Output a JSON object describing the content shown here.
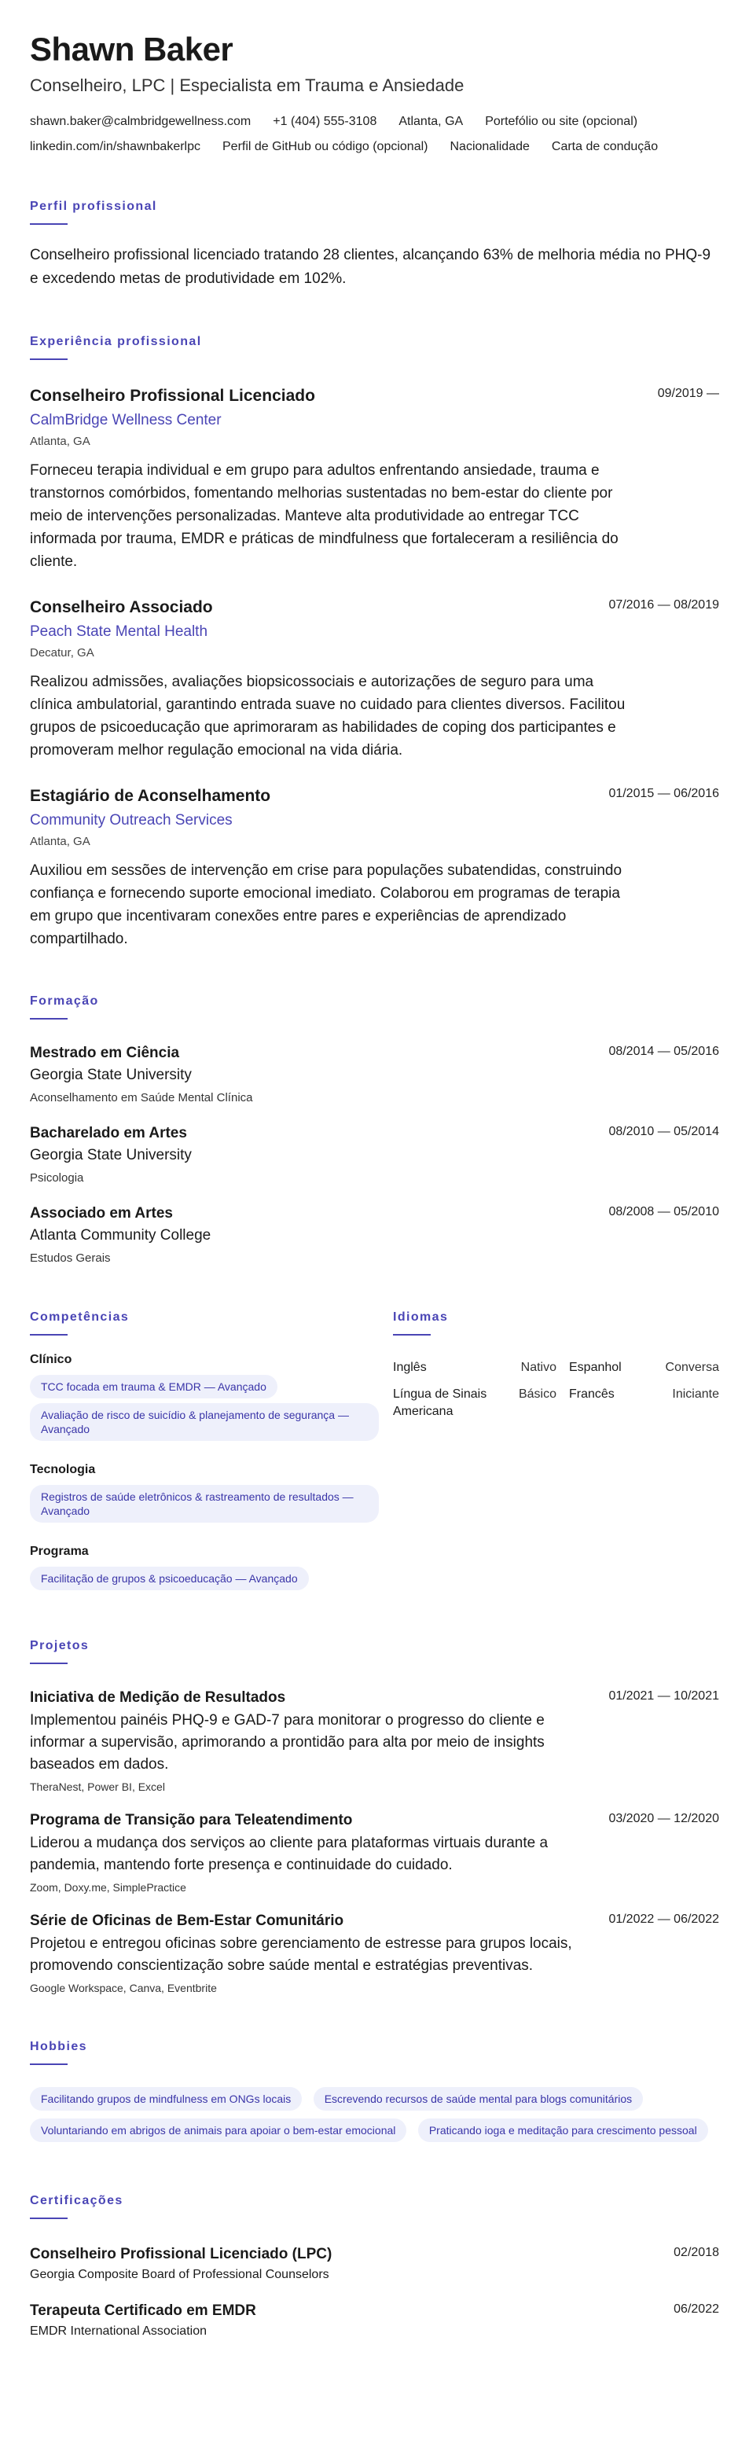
{
  "header": {
    "name": "Shawn Baker",
    "headline": "Conselheiro, LPC | Especialista em Trauma e Ansiedade",
    "contacts": [
      "shawn.baker@calmbridgewellness.com",
      "+1 (404) 555-3108",
      "Atlanta, GA",
      "Portefólio ou site (opcional)",
      "linkedin.com/in/shawnbakerlpc",
      "Perfil de GitHub ou código (opcional)",
      "Nacionalidade",
      "Carta de condução"
    ]
  },
  "summary": {
    "title": "Perfil profissional",
    "text": "Conselheiro profissional licenciado tratando 28 clientes, alcançando 63% de melhoria média no PHQ-9 e excedendo metas de produtividade em 102%."
  },
  "experience": {
    "title": "Experiência profissional",
    "items": [
      {
        "title": "Conselheiro Profissional Licenciado",
        "date": "09/2019 —",
        "org": "CalmBridge Wellness Center",
        "location": "Atlanta, GA",
        "desc": "Forneceu terapia individual e em grupo para adultos enfrentando ansiedade, trauma e transtornos comórbidos, fomentando melhorias sustentadas no bem-estar do cliente por meio de intervenções personalizadas. Manteve alta produtividade ao entregar TCC informada por trauma, EMDR e práticas de mindfulness que fortaleceram a resiliência do cliente."
      },
      {
        "title": "Conselheiro Associado",
        "date": "07/2016 — 08/2019",
        "org": "Peach State Mental Health",
        "location": "Decatur, GA",
        "desc": "Realizou admissões, avaliações biopsicossociais e autorizações de seguro para uma clínica ambulatorial, garantindo entrada suave no cuidado para clientes diversos. Facilitou grupos de psicoeducação que aprimoraram as habilidades de coping dos participantes e promoveram melhor regulação emocional na vida diária."
      },
      {
        "title": "Estagiário de Aconselhamento",
        "date": "01/2015 — 06/2016",
        "org": "Community Outreach Services",
        "location": "Atlanta, GA",
        "desc": "Auxiliou em sessões de intervenção em crise para populações subatendidas, construindo confiança e fornecendo suporte emocional imediato. Colaborou em programas de terapia em grupo que incentivaram conexões entre pares e experiências de aprendizado compartilhado."
      }
    ]
  },
  "education": {
    "title": "Formação",
    "items": [
      {
        "degree": "Mestrado em Ciência",
        "date": "08/2014 — 05/2016",
        "school": "Georgia State University",
        "field": "Aconselhamento em Saúde Mental Clínica"
      },
      {
        "degree": "Bacharelado em Artes",
        "date": "08/2010 — 05/2014",
        "school": "Georgia State University",
        "field": "Psicologia"
      },
      {
        "degree": "Associado em Artes",
        "date": "08/2008 — 05/2010",
        "school": "Atlanta Community College",
        "field": "Estudos Gerais"
      }
    ]
  },
  "skills": {
    "title": "Competências",
    "groups": [
      {
        "name": "Clínico",
        "items": [
          "TCC focada em trauma & EMDR — Avançado",
          "Avaliação de risco de suicídio & planejamento de segurança — Avançado"
        ]
      },
      {
        "name": "Tecnologia",
        "items": [
          "Registros de saúde eletrônicos & rastreamento de resultados — Avançado"
        ]
      },
      {
        "name": "Programa",
        "items": [
          "Facilitação de grupos & psicoeducação — Avançado"
        ]
      }
    ]
  },
  "languages": {
    "title": "Idiomas",
    "items": [
      {
        "name": "Inglês",
        "level": "Nativo"
      },
      {
        "name": "Espanhol",
        "level": "Conversa"
      },
      {
        "name": "Língua de Sinais Americana",
        "level": "Básico"
      },
      {
        "name": "Francês",
        "level": "Iniciante"
      }
    ]
  },
  "projects": {
    "title": "Projetos",
    "items": [
      {
        "title": "Iniciativa de Medição de Resultados",
        "date": "01/2021 — 10/2021",
        "desc": "Implementou painéis PHQ-9 e GAD-7 para monitorar o progresso do cliente e informar a supervisão, aprimorando a prontidão para alta por meio de insights baseados em dados.",
        "tech": "TheraNest, Power BI, Excel"
      },
      {
        "title": "Programa de Transição para Teleatendimento",
        "date": "03/2020 — 12/2020",
        "desc": "Liderou a mudança dos serviços ao cliente para plataformas virtuais durante a pandemia, mantendo forte presença e continuidade do cuidado.",
        "tech": "Zoom, Doxy.me, SimplePractice"
      },
      {
        "title": "Série de Oficinas de Bem-Estar Comunitário",
        "date": "01/2022 — 06/2022",
        "desc": "Projetou e entregou oficinas sobre gerenciamento de estresse para grupos locais, promovendo conscientização sobre saúde mental e estratégias preventivas.",
        "tech": "Google Workspace, Canva, Eventbrite"
      }
    ]
  },
  "hobbies": {
    "title": "Hobbies",
    "items": [
      "Facilitando grupos de mindfulness em ONGs locais",
      "Escrevendo recursos de saúde mental para blogs comunitários",
      "Voluntariando em abrigos de animais para apoiar o bem-estar emocional",
      "Praticando ioga e meditação para crescimento pessoal"
    ]
  },
  "certifications": {
    "title": "Certificações",
    "items": [
      {
        "title": "Conselheiro Profissional Licenciado (LPC)",
        "date": "02/2018",
        "issuer": "Georgia Composite Board of Professional Counselors"
      },
      {
        "title": "Terapeuta Certificado em EMDR",
        "date": "06/2022",
        "issuer": "EMDR International Association"
      }
    ]
  }
}
